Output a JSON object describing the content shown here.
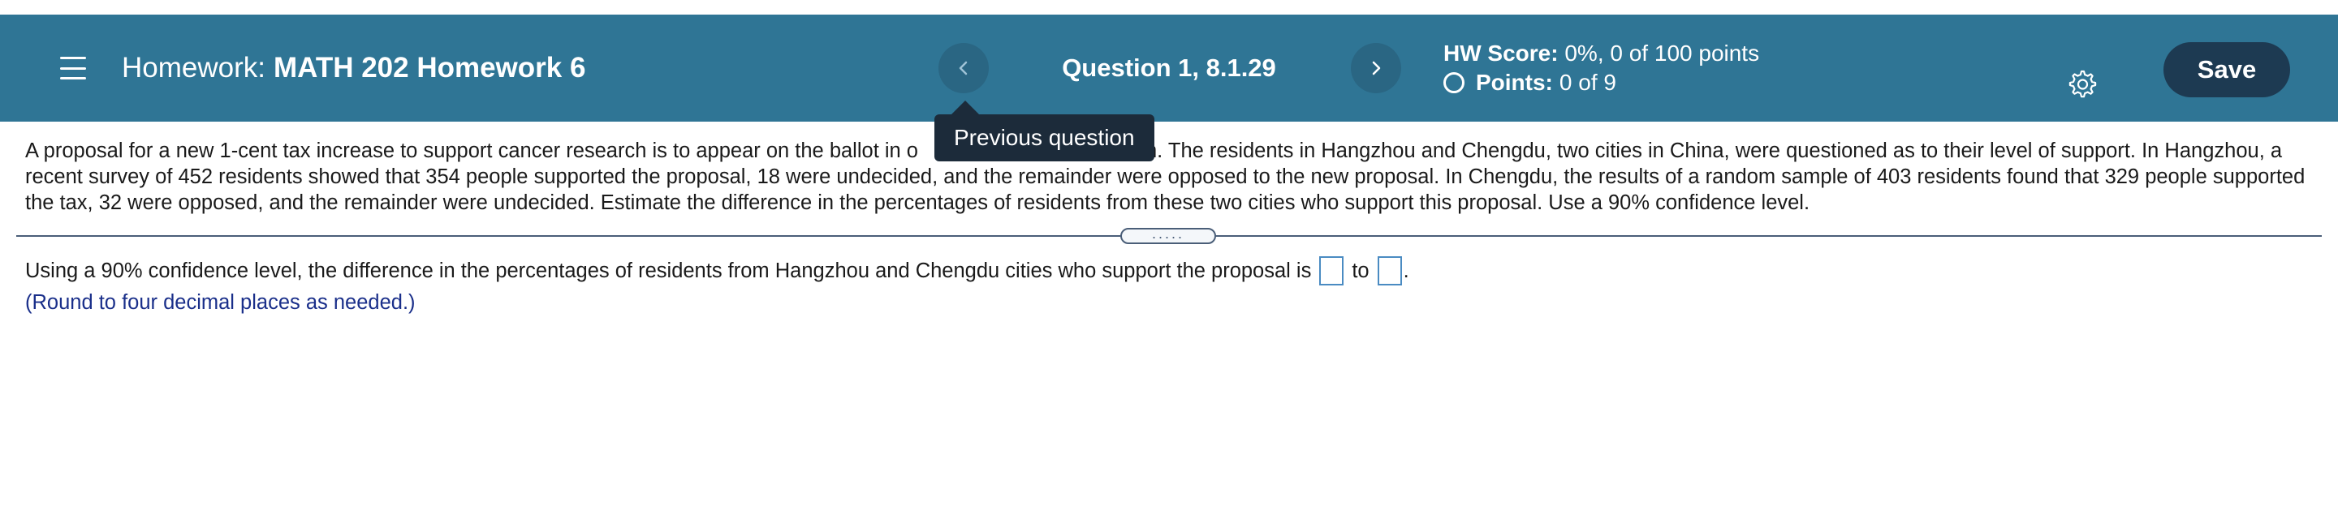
{
  "header": {
    "title_prefix": "Homework:",
    "title_name": "MATH 202 Homework 6",
    "question_label": "Question 1, 8.1.29",
    "score_label": "HW Score:",
    "score_value": "0%, 0 of 100 points",
    "points_label": "Points:",
    "points_value": "0 of 9",
    "save_label": "Save",
    "icons": {
      "menu": "menu-icon",
      "prev": "chevron-left-icon",
      "next": "chevron-right-icon",
      "points_status": "circle-icon",
      "settings": "gear-icon"
    },
    "colors": {
      "header_bg": "#2f7595",
      "save_bg": "#1d3a52",
      "tooltip_bg": "#1c2b3a"
    }
  },
  "tooltip": {
    "text": "Previous question"
  },
  "problem": {
    "text_part1": "A proposal for a new 1-cent tax increase to support cancer research is to appear on the ballot in o",
    "text_part2": "n. The residents in Hangzhou and Chengdu, two cities in China, were questioned as to their level of support. In Hangzhou, a recent survey of 452 residents showed that 354 people supported the proposal, 18 were undecided, and the remainder were opposed to the new proposal. In Chengdu, the results of a random sample of 403 residents found that 329 people supported the tax, 32 were opposed, and the remainder were undecided. Estimate the difference in the percentages of residents from these two cities who support this proposal. Use a 90% confidence level."
  },
  "answer": {
    "prompt": "Using a 90% confidence level, the difference in the percentages of residents from Hangzhou and Chengdu cities who support the proposal is",
    "lower_value": "",
    "connector": "to",
    "upper_value": "",
    "end_punct": ".",
    "hint": "(Round to four decimal places as needed.)"
  }
}
